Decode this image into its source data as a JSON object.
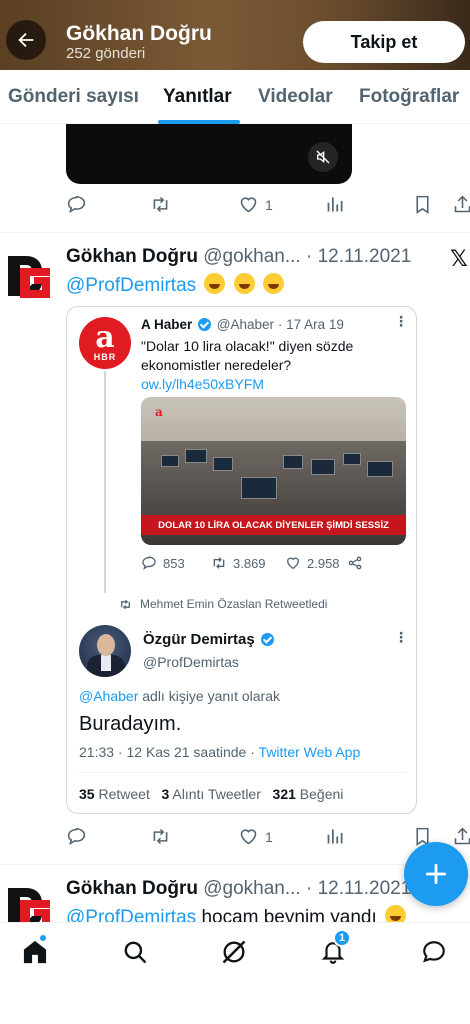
{
  "header": {
    "name": "Gökhan Doğru",
    "post_count": "252 gönderi",
    "follow_label": "Takip et"
  },
  "tabs": [
    {
      "label": "Gönderi sayısı",
      "active": false
    },
    {
      "label": "Yanıtlar",
      "active": true
    },
    {
      "label": "Videolar",
      "active": false
    },
    {
      "label": "Fotoğraflar",
      "active": false
    }
  ],
  "prev_tweet": {
    "like_count": "1"
  },
  "tweet": {
    "name": "Gökhan Doğru",
    "handle": "@gokhan...",
    "date": "12.11.2021",
    "mention": "@ProfDemirtas",
    "like_count": "1",
    "embed": {
      "top": {
        "logo_text": "a",
        "logo_sub": "HBR",
        "name": "A Haber",
        "handle": "@Ahaber",
        "date": "17 Ara 19",
        "text": "\"Dolar 10 lira olacak!\" diyen sözde ekonomistler neredeler?",
        "link": "ow.ly/lh4e50xBYFM",
        "image_banner": "DOLAR 10 LİRA OLACAK DİYENLER ŞİMDİ SESSİZ",
        "image_logo": "a",
        "replies": "853",
        "retweets": "3.869",
        "likes": "2.958"
      },
      "retweet_note": "Mehmet Emin Özaslan Retweetledi",
      "reply": {
        "name": "Özgür Demirtaş",
        "handle": "@ProfDemirtas",
        "reply_to_mention": "@Ahaber",
        "reply_to_suffix": "adlı kişiye yanıt olarak",
        "text": "Buradayım.",
        "time": "21:33 · 12 Kas 21 saatinde · ",
        "source": "Twitter Web App",
        "retweets_num": "35",
        "retweets_label": "Retweet",
        "quotes_num": "3",
        "quotes_label": "Alıntı Tweetler",
        "likes_num": "321",
        "likes_label": "Beğeni"
      }
    }
  },
  "next_tweet": {
    "name": "Gökhan Doğru",
    "handle": "@gokhan...",
    "date": "12.11.2021",
    "mention": "@ProfDemirtas",
    "text": "hocam beynim yandı"
  },
  "bottom_nav": {
    "notification_count": "1"
  },
  "colors": {
    "accent": "#1d9bf0",
    "text": "#0f1419",
    "muted": "#536471",
    "ahaber_red": "#e11b22"
  }
}
